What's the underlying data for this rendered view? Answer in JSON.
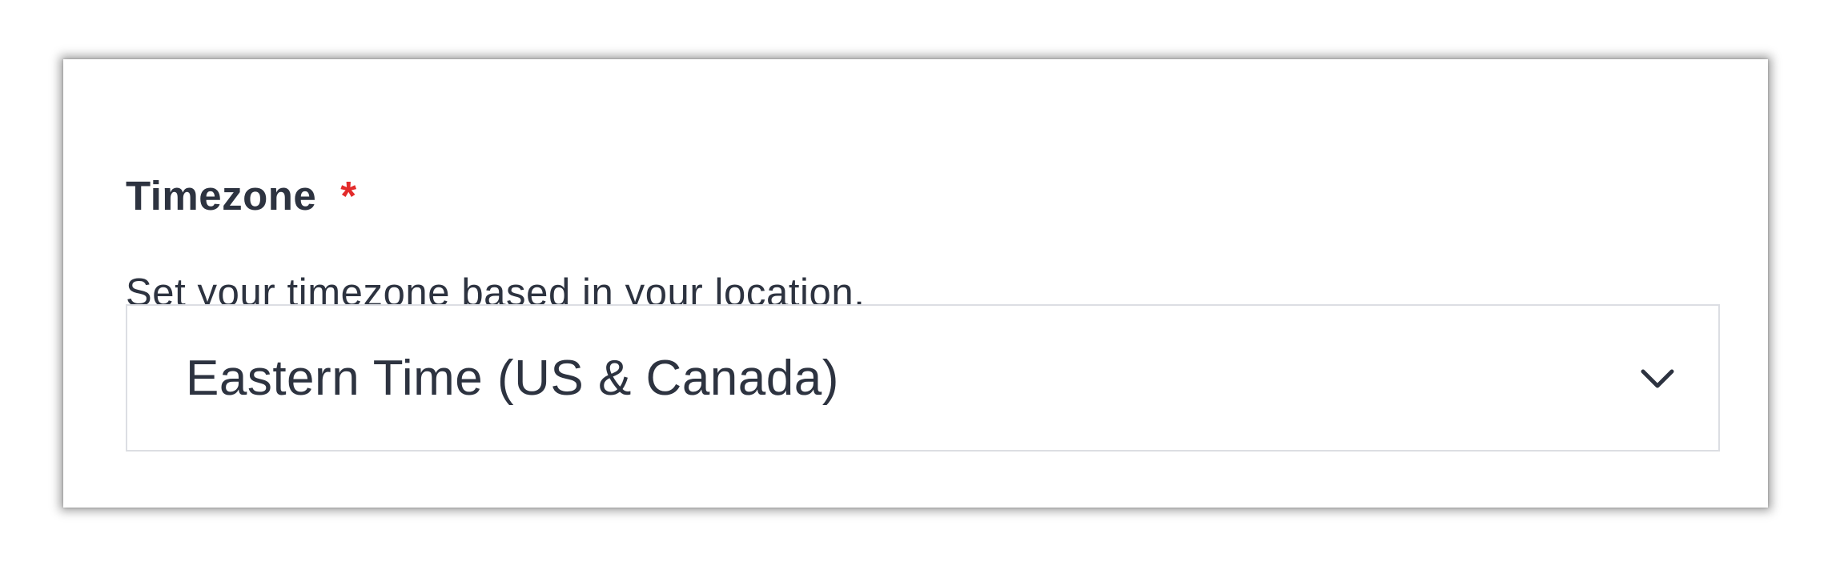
{
  "timezone_field": {
    "label": "Timezone",
    "required_mark": "*",
    "help_text": "Set your timezone based in your location.",
    "selected_value": "Eastern Time (US & Canada)",
    "dropdown_icon": "chevron-down-icon"
  },
  "colors": {
    "text": "#2d3340",
    "required": "#e32b2b",
    "border": "#dcdee3"
  }
}
